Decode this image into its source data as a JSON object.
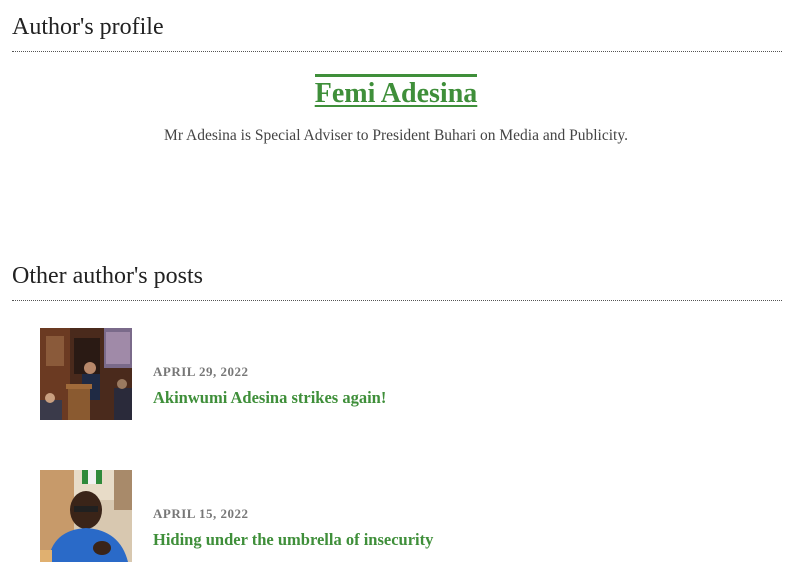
{
  "profile": {
    "heading": "Author's profile",
    "name": "Femi Adesina",
    "bio": "Mr Adesina is Special Adviser to President Buhari on Media and Publicity."
  },
  "posts": {
    "heading": "Other author's posts",
    "items": [
      {
        "date": "APRIL 29, 2022",
        "title": "Akinwumi Adesina strikes again!"
      },
      {
        "date": "APRIL 15, 2022",
        "title": "Hiding under the umbrella of insecurity"
      }
    ]
  },
  "colors": {
    "accent": "#3f8f3a",
    "date": "#777777",
    "text": "#222222"
  }
}
